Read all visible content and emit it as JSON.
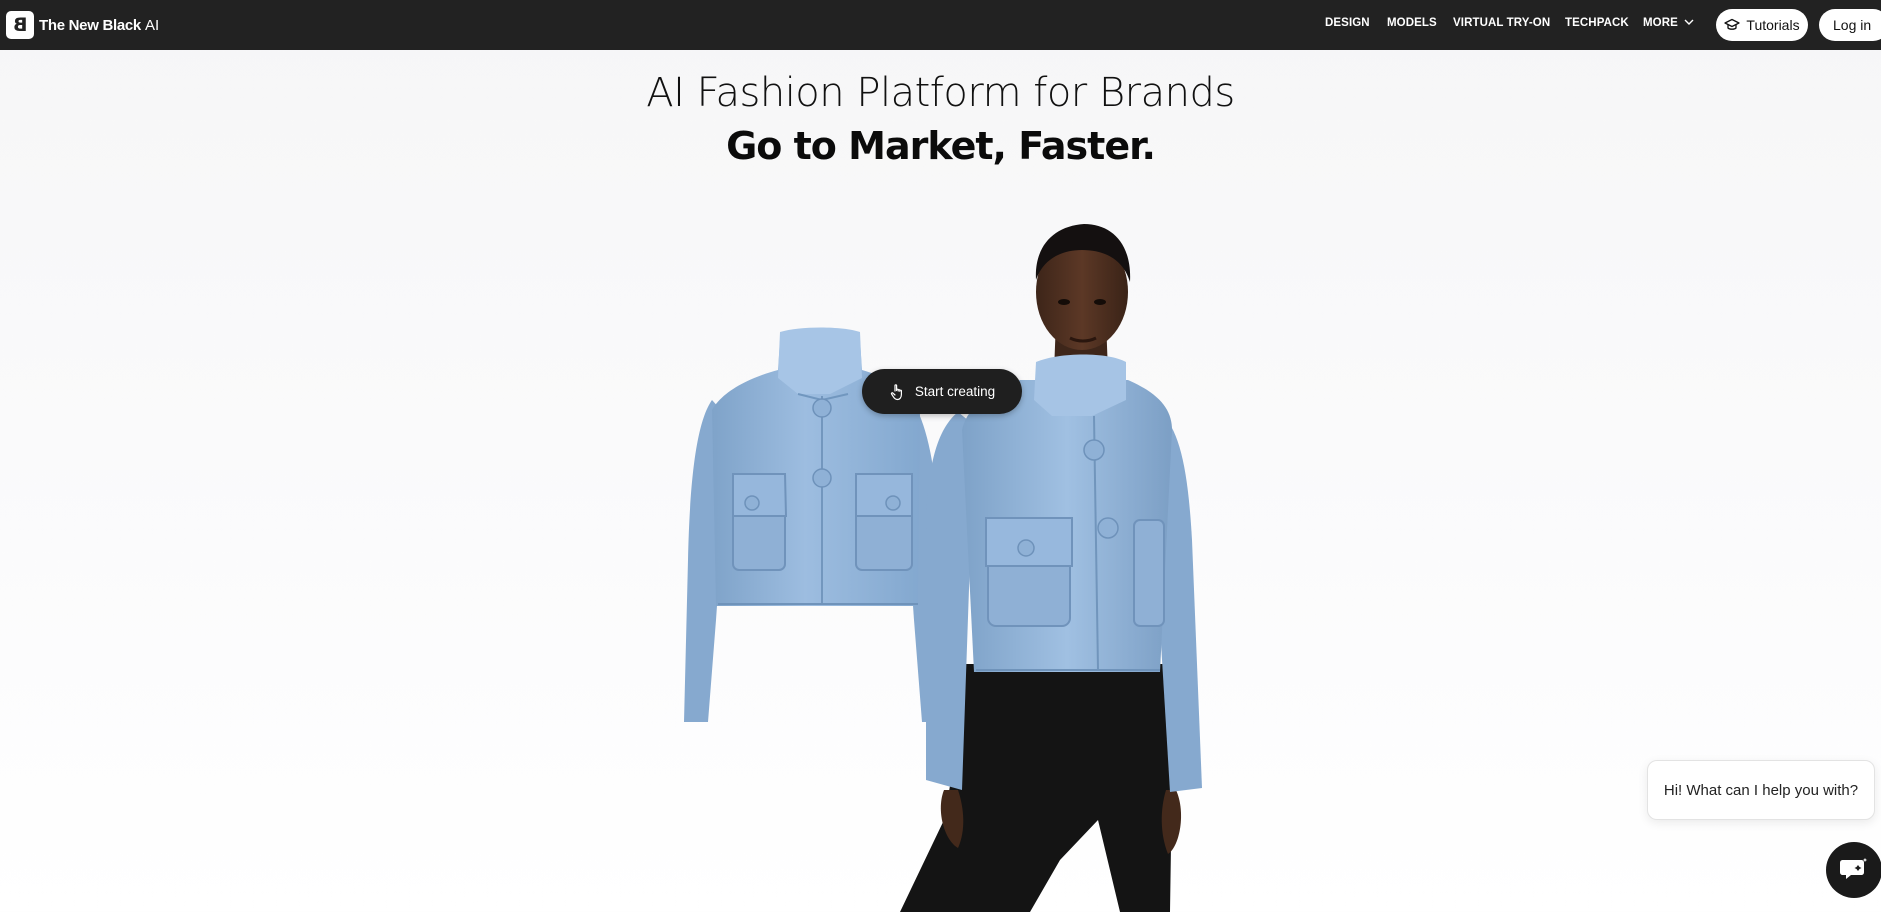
{
  "brand": {
    "name": "The New Black",
    "suffix": "AI",
    "logo_glyph": "B"
  },
  "nav": {
    "links": [
      "DESIGN",
      "MODELS",
      "VIRTUAL TRY-ON",
      "TECHPACK",
      "MORE"
    ],
    "tutorials_label": "Tutorials",
    "login_label": "Log in"
  },
  "hero": {
    "title": "AI Fashion Platform for Brands",
    "subtitle": "Go to Market, Faster.",
    "cta_label": "Start creating"
  },
  "chat": {
    "greeting": "Hi! What can I help you with?"
  },
  "colors": {
    "nav_bg": "#222222",
    "jacket": "#93b4d6",
    "cta_bg": "#1f1f1f",
    "page_bg": "#f6f6f7"
  },
  "icons": [
    "mortarboard-icon",
    "chevron-down-icon",
    "hand-pointer-icon",
    "chat-icon"
  ]
}
